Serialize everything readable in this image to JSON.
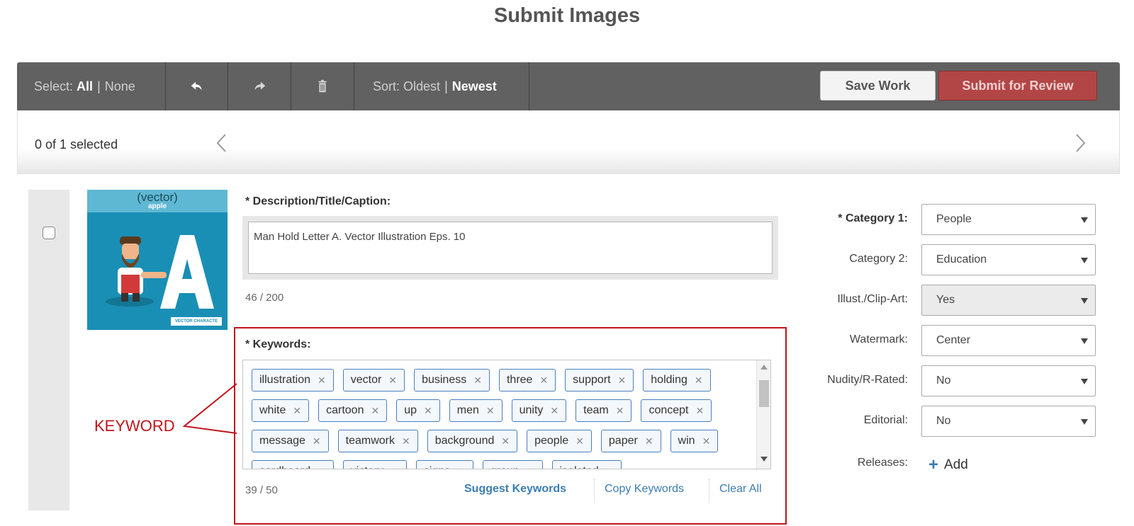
{
  "page": {
    "title": "Submit Images"
  },
  "toolbar": {
    "select_prefix": "Select:",
    "select_all": "All",
    "select_none": "None",
    "sort_prefix": "Sort:",
    "sort_oldest": "Oldest",
    "sort_newest": "Newest",
    "save_label": "Save Work",
    "submit_label": "Submit for Review",
    "icons": [
      "undo-icon",
      "redo-icon",
      "trash-icon"
    ]
  },
  "selection": {
    "count_text": "0 of 1 selected"
  },
  "item": {
    "thumbnail": {
      "label_top": "(vector)",
      "label_small": "apple",
      "badge": "VECTOR CHARACTE"
    },
    "description_label": "* Description/Title/Caption:",
    "description_value": "Man Hold Letter A. Vector Illustration Eps. 10",
    "description_count": "46 / 200",
    "keywords_label": "* Keywords:",
    "keywords": [
      "illustration",
      "vector",
      "business",
      "three",
      "support",
      "holding",
      "white",
      "cartoon",
      "up",
      "men",
      "unity",
      "team",
      "concept",
      "message",
      "teamwork",
      "background",
      "people",
      "paper",
      "win",
      "cardboard",
      "victory",
      "signs",
      "group",
      "isolated"
    ],
    "keywords_count": "39 / 50",
    "suggest_label": "Suggest Keywords",
    "copy_label": "Copy Keywords",
    "clear_label": "Clear All",
    "remove_glyph": "✕"
  },
  "annotation": {
    "label": "KEYWORD",
    "color": "#c0141c"
  },
  "fields": [
    {
      "label": "* Category 1:",
      "value": "People",
      "required": true,
      "disabled": false
    },
    {
      "label": "Category 2:",
      "value": "Education",
      "required": false,
      "disabled": false
    },
    {
      "label": "Illust./Clip-Art:",
      "value": "Yes",
      "required": false,
      "disabled": true
    },
    {
      "label": "Watermark:",
      "value": "Center",
      "required": false,
      "disabled": false
    },
    {
      "label": "Nudity/R-Rated:",
      "value": "No",
      "required": false,
      "disabled": false
    },
    {
      "label": "Editorial:",
      "value": "No",
      "required": false,
      "disabled": false
    }
  ],
  "releases": {
    "label": "Releases:",
    "add_label": "Add"
  },
  "colors": {
    "toolbar": "#616161",
    "submit": "#b24646",
    "link": "#3b7db2",
    "tag_border": "#4a7fbf"
  }
}
